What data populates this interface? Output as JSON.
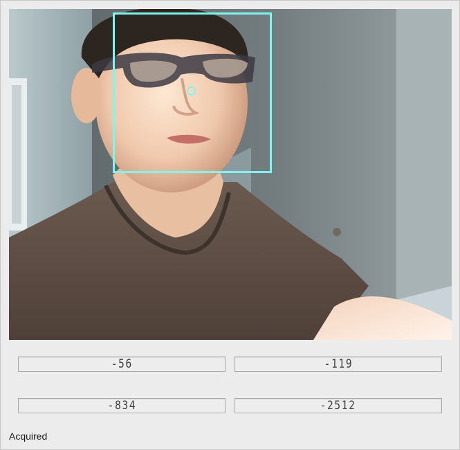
{
  "camera": {
    "overlay_color": "#7ff5f2"
  },
  "readouts": {
    "top_left": "-56",
    "top_right": "-119",
    "bottom_left": "-834",
    "bottom_right": "-2512"
  },
  "status_bar": {
    "text": "Acquired"
  }
}
